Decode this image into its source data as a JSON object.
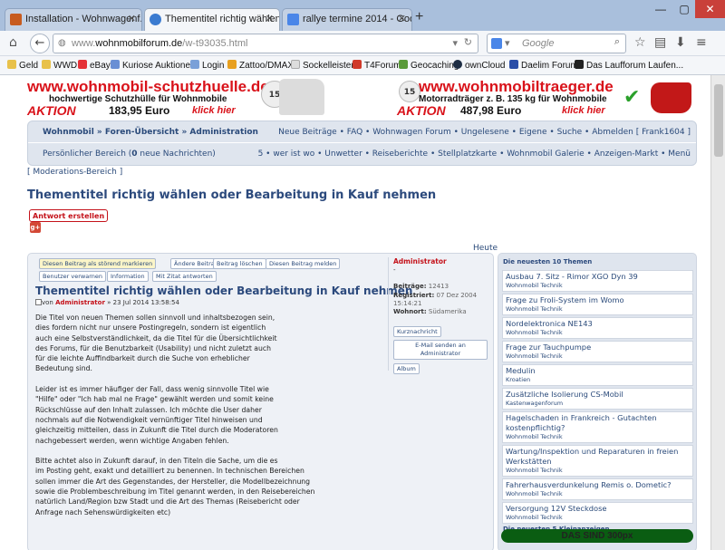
{
  "browser": {
    "tabs": [
      {
        "label": "Installation - Wohnwagenf..."
      },
      {
        "label": "Thementitel richtig wählen..."
      },
      {
        "label": "rallye termine 2014 - Googl..."
      }
    ],
    "url_prefix": "www.",
    "url_domain": "wohnmobilforum.de",
    "url_path": "/w-t93035.html",
    "search_placeholder": "Google",
    "bookmarks": [
      "Geld",
      "WWD",
      "eBay",
      "Kuriose Auktionen",
      "Login",
      "Zattoo/DMAX",
      "Sockelleisten",
      "T4Forum",
      "Geocaching",
      "ownCloud",
      "Daelim Forum",
      "Das Laufforum Laufen..."
    ]
  },
  "banners": {
    "left": {
      "title": "www.wohnmobil-schutzhuelle.de",
      "sub": "hochwertige Schutzhülle für Wohnmobile",
      "aktion": "AKTION",
      "price": "183,95 Euro",
      "klick": "klick hier",
      "badge": "15"
    },
    "right": {
      "title": "www.wohnmobiltraeger.de",
      "sub": "Motorradträger z. B. 135 kg für Wohnmobile",
      "aktion": "AKTION",
      "price": "487,98 Euro",
      "klick": "klick hier",
      "badge": "15"
    }
  },
  "forum_nav": {
    "crumb1": "Wohnmobil",
    "crumb2": "Foren-Übersicht",
    "crumb3": "Administration",
    "links": [
      "Neue Beiträge",
      "FAQ",
      "Wohnwagen Forum",
      "Ungelesene",
      "Eigene",
      "Suche",
      "Abmelden [ Frank1604 ]"
    ],
    "personal": "Persönlicher Bereich",
    "pm_count": "0",
    "pm_label": "neue Nachrichten",
    "links2": [
      "5",
      "wer ist wo",
      "Unwetter",
      "Reiseberichte",
      "Stellplatzkarte",
      "Wohnmobil Galerie",
      "Anzeigen-Markt",
      "Menü"
    ]
  },
  "moderation": "Moderations-Bereich",
  "thread_title": "Thementitel richtig wählen oder Bearbeitung in Kauf nehmen",
  "reply_button": "Antwort erstellen",
  "heute": "Heute",
  "post": {
    "buttons_row1": [
      "Diesen Beitrag als störend markieren",
      "Ändere Beitrag",
      "Beitrag löschen",
      "Diesen Beitrag melden"
    ],
    "buttons_row2": [
      "Benutzer verwarnen",
      "Information",
      "Mit Zitat antworten"
    ],
    "title": "Thementitel richtig wählen oder Bearbeitung in Kauf nehmen",
    "meta_von": "von",
    "meta_author": "Administrator",
    "meta_date": "» 23 Jul 2014 13:58:54",
    "paragraphs": [
      [
        "Die Titel von neuen Themen sollen sinnvoll und inhaltsbezogen sein,",
        "dies fordern nicht nur unsere Postingregeln, sondern ist eigentlich",
        "auch eine Selbstverständlichkeit, da die Titel für die Übersichtlichkeit",
        "des Forums, für die Benutzbarkeit (Usability) und nicht zuletzt auch",
        "für die leichte Auffindbarkeit durch die Suche von erheblicher",
        "Bedeutung sind."
      ],
      [
        "Leider ist es immer häufiger der Fall, dass wenig sinnvolle Titel wie",
        "\"Hilfe\" oder \"Ich hab mal ne Frage\" gewählt werden und somit keine",
        "Rückschlüsse auf den Inhalt zulassen. Ich möchte die User daher",
        "nochmals auf die Notwendigkeit vernünftiger Titel hinweisen und",
        "gleichzeitig mitteilen, dass in Zukunft die Titel durch die Moderatoren",
        "nachgebessert werden, wenn wichtige Angaben fehlen."
      ],
      [
        "Bitte achtet also in Zukunft darauf, in den Titeln die Sache, um die es",
        "im Posting geht, exakt und detailliert zu benennen. In technischen Bereichen",
        "sollen immer die Art des Gegenstandes, der Hersteller, die Modellbezeichnung",
        "sowie die Problembeschreibung im Titel genannt werden, in den Reisebereichen",
        "natürlich Land/Region bzw Stadt und die Art des Themas (Reisebericht oder",
        "Anfrage nach Sehenswürdigkeiten etc)"
      ]
    ]
  },
  "profile": {
    "name": "Administrator",
    "dash": "-",
    "beitraege_label": "Beiträge:",
    "beitraege": "12413",
    "registriert_label": "Registriert:",
    "registriert": "07 Dez 2004",
    "registriert_time": "15:14:21",
    "wohnort_label": "Wohnort:",
    "wohnort": "Südamerika",
    "btn_pm": "Kurznachricht",
    "btn_mail1": "E-Mail senden an",
    "btn_mail2": "Administrator",
    "btn_album": "Album"
  },
  "sidebar": {
    "heading": "Die neuesten 10 Themen",
    "items": [
      {
        "title": "Ausbau 7. Sitz - Rimor XGO Dyn 39",
        "sub": "Wohnmobil Technik"
      },
      {
        "title": "Frage zu Froli-System im Womo",
        "sub": "Wohnmobil Technik"
      },
      {
        "title": "Nordelektronica NE143",
        "sub": "Wohnmobil Technik"
      },
      {
        "title": "Frage zur Tauchpumpe",
        "sub": "Wohnmobil Technik"
      },
      {
        "title": "Medulin",
        "sub": "Kroatien"
      },
      {
        "title": "Zusätzliche Isolierung CS-Mobil",
        "sub": "Kastenwagenforum"
      },
      {
        "title": "Hagelschaden in Frankreich - Gutachten kostenpflichtig?",
        "sub": "Wohnmobil Technik"
      },
      {
        "title": "Wartung/Inspektion und Reparaturen in freien Werkstätten",
        "sub": "Wohnmobil Technik"
      },
      {
        "title": "Fahrerhausverdunkelung Remis o. Dometic?",
        "sub": "Wohnmobil Technik"
      },
      {
        "title": "Versorgung 12V Steckdose",
        "sub": "Wohnmobil Technik"
      }
    ],
    "heading2": "Die neuesten 5 Kleinanzeigen",
    "green_bar": "DAS SIND 300px"
  }
}
